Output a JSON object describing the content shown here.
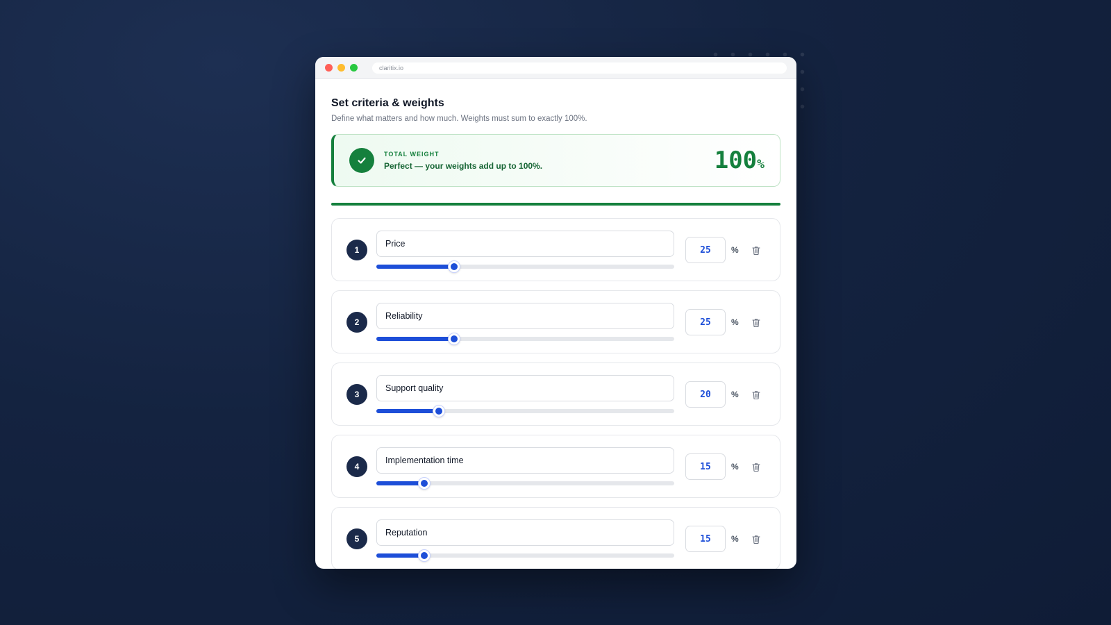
{
  "browser": {
    "url": "claritix.io"
  },
  "header": {
    "title": "Set criteria & weights",
    "subtitle": "Define what matters and how much. Weights must sum to exactly 100%."
  },
  "total": {
    "label": "TOTAL WEIGHT",
    "message": "Perfect — your weights add up to 100%.",
    "value": "100",
    "unit": "%",
    "progress_percent": 100,
    "status_color": "#15803d"
  },
  "criteria": [
    {
      "index": "1",
      "name": "Price",
      "weight": "25",
      "unit": "%"
    },
    {
      "index": "2",
      "name": "Reliability",
      "weight": "25",
      "unit": "%"
    },
    {
      "index": "3",
      "name": "Support quality",
      "weight": "20",
      "unit": "%"
    },
    {
      "index": "4",
      "name": "Implementation time",
      "weight": "15",
      "unit": "%"
    },
    {
      "index": "5",
      "name": "Reputation",
      "weight": "15",
      "unit": "%"
    }
  ],
  "slider_fill_percent": [
    26,
    26,
    21,
    16,
    16
  ],
  "colors": {
    "accent": "#1d4ed8",
    "badge": "#1b2a4a",
    "success": "#15803d"
  },
  "icons": {
    "check": "check-icon",
    "delete": "trash-icon"
  }
}
